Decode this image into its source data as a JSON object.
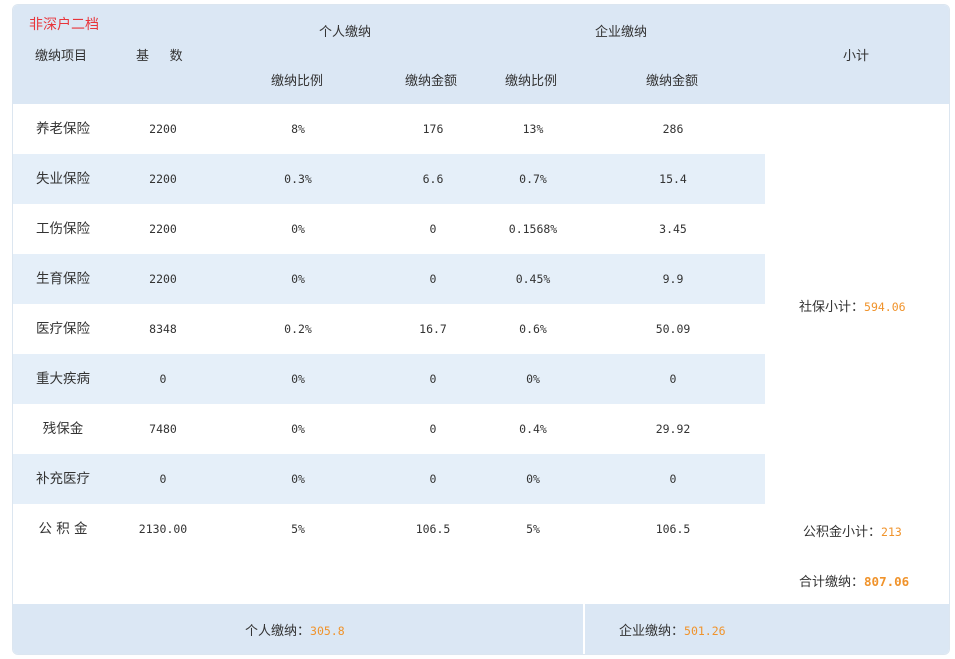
{
  "tag": "非深户二档",
  "header": {
    "item": "缴纳项目",
    "base": "基     数",
    "personal": "个人缴纳",
    "enterprise": "企业缴纳",
    "subtotal": "小计",
    "p_rate": "缴纳比例",
    "p_amount": "缴纳金额",
    "e_rate": "缴纳比例",
    "e_amount": "缴纳金额"
  },
  "rows": [
    {
      "name": "养老保险",
      "base": "2200",
      "p_rate": "8%",
      "p_amount": "176",
      "e_rate": "13%",
      "e_amount": "286"
    },
    {
      "name": "失业保险",
      "base": "2200",
      "p_rate": "0.3%",
      "p_amount": "6.6",
      "e_rate": "0.7%",
      "e_amount": "15.4"
    },
    {
      "name": "工伤保险",
      "base": "2200",
      "p_rate": "0%",
      "p_amount": "0",
      "e_rate": "0.1568%",
      "e_amount": "3.45"
    },
    {
      "name": "生育保险",
      "base": "2200",
      "p_rate": "0%",
      "p_amount": "0",
      "e_rate": "0.45%",
      "e_amount": "9.9"
    },
    {
      "name": "医疗保险",
      "base": "8348",
      "p_rate": "0.2%",
      "p_amount": "16.7",
      "e_rate": "0.6%",
      "e_amount": "50.09"
    },
    {
      "name": "重大疾病",
      "base": "0",
      "p_rate": "0%",
      "p_amount": "0",
      "e_rate": "0%",
      "e_amount": "0"
    },
    {
      "name": "残保金",
      "base": "7480",
      "p_rate": "0%",
      "p_amount": "0",
      "e_rate": "0.4%",
      "e_amount": "29.92"
    },
    {
      "name": "补充医疗",
      "base": "0",
      "p_rate": "0%",
      "p_amount": "0",
      "e_rate": "0%",
      "e_amount": "0"
    },
    {
      "name": "公 积 金",
      "base": "2130.00",
      "p_rate": "5%",
      "p_amount": "106.5",
      "e_rate": "5%",
      "e_amount": "106.5"
    }
  ],
  "summary": {
    "social_label": "社保小计：",
    "social_value": "594.06",
    "fund_label": "公积金小计：",
    "fund_value": "213",
    "total_label": "合计缴纳：",
    "total_value": "807.06"
  },
  "footer": {
    "personal_label": "个人缴纳：",
    "personal_value": "305.8",
    "enterprise_label": "企业缴纳：",
    "enterprise_value": "501.26"
  },
  "colors": {
    "header_bg": "#dbe7f4",
    "alt_row_bg": "#e5eff9",
    "accent_orange": "#f0932b",
    "tag_red": "#e8343a"
  }
}
